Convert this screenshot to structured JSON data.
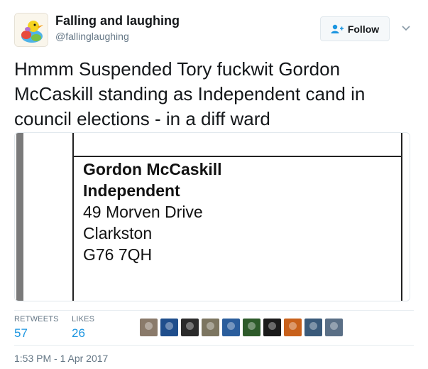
{
  "author": {
    "name": "Falling and laughing",
    "handle": "@fallinglaughing"
  },
  "follow_button": {
    "label": "Follow"
  },
  "tweet": {
    "text": "Hmmm Suspended Tory fuckwit Gordon McCaskill standing as Independent cand in council elections - in a diff ward"
  },
  "ballot": {
    "name": "Gordon McCaskill",
    "party": "Independent",
    "address_line1": "49 Morven Drive",
    "address_line2": "Clarkston",
    "postcode": "G76 7QH"
  },
  "stats": {
    "retweets_label": "RETWEETS",
    "retweets_value": "57",
    "likes_label": "LIKES",
    "likes_value": "26"
  },
  "likers": [
    {
      "color": "#8a7a6a"
    },
    {
      "color": "#1f4e8c"
    },
    {
      "color": "#2b2b2b"
    },
    {
      "color": "#7c7560"
    },
    {
      "color": "#2a5d9c"
    },
    {
      "color": "#2d5a2a"
    },
    {
      "color": "#1a1a1a"
    },
    {
      "color": "#c8611b"
    },
    {
      "color": "#3a5a7a"
    },
    {
      "color": "#5a6f86"
    }
  ],
  "timestamp": "1:53 PM - 1 Apr 2017"
}
